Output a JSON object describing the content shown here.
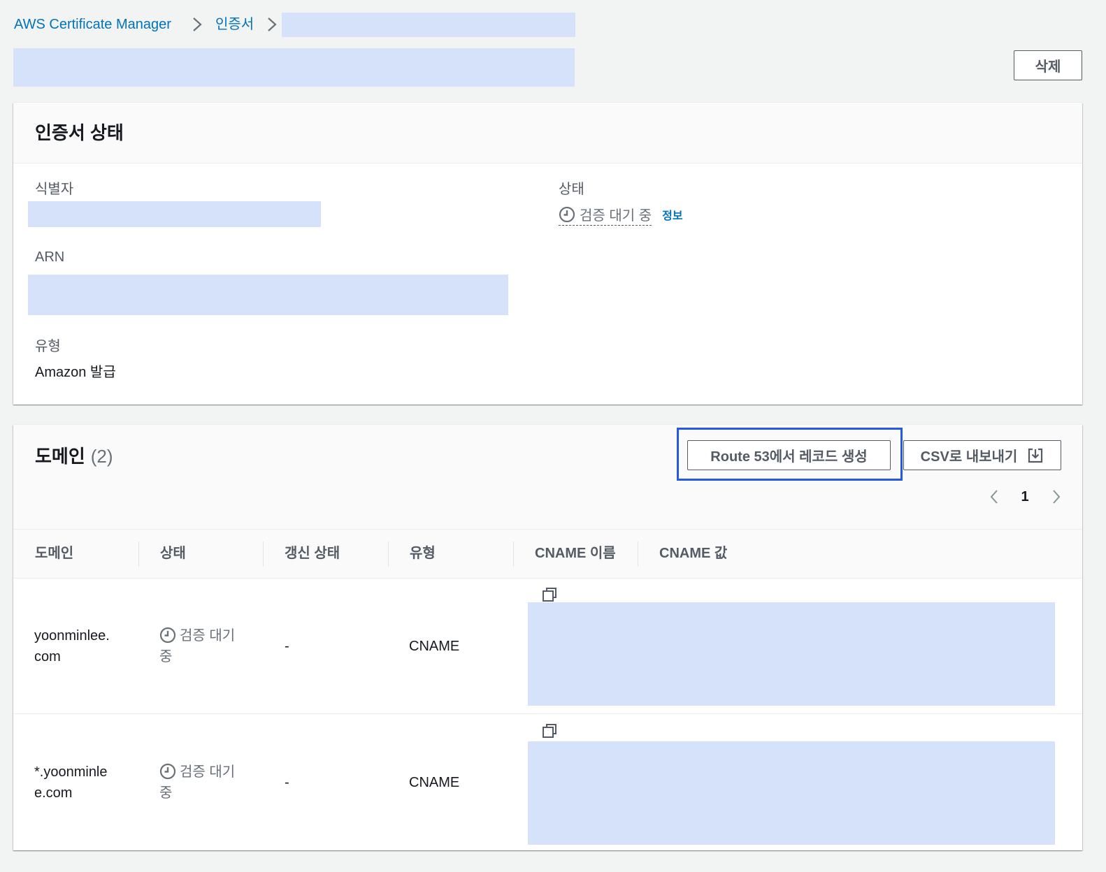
{
  "colors": {
    "page_background": "#f2f3f3",
    "link": "#0073bb",
    "text": "#16191f",
    "secondary_text": "#545b64",
    "pending_status": "#687078",
    "highlight_border": "#2459e6",
    "redacted_fill": "#d6e1fa"
  },
  "icons": {
    "breadcrumb_separator": "chevron-right-icon",
    "status": "clock-icon",
    "copy": "copy-icon",
    "export": "download-icon",
    "page_prev": "chevron-left-icon",
    "page_next": "chevron-right-icon"
  },
  "breadcrumb": {
    "items": [
      {
        "label": "AWS Certificate Manager"
      },
      {
        "label": "인증서"
      }
    ]
  },
  "header": {
    "delete_label": "삭제"
  },
  "status_panel": {
    "title": "인증서 상태",
    "identifier_label": "식별자",
    "arn_label": "ARN",
    "type_label": "유형",
    "type_value": "Amazon 발급",
    "status_label": "상태",
    "status_value": "검증 대기 중",
    "info_link": "정보"
  },
  "domains_panel": {
    "title": "도메인",
    "count_label": "(2)",
    "route53_button": "Route 53에서 레코드 생성",
    "csv_button": "CSV로 내보내기",
    "pagination": {
      "current_page": "1"
    },
    "columns": [
      "도메인",
      "상태",
      "갱신 상태",
      "유형",
      "CNAME 이름",
      "CNAME 값"
    ],
    "rows": [
      {
        "domain": "yoonminlee.com",
        "status": "검증 대기 중",
        "renewal_status": "-",
        "type": "CNAME"
      },
      {
        "domain": "*.yoonminlee.com",
        "status": "검증 대기 중",
        "renewal_status": "-",
        "type": "CNAME"
      }
    ]
  }
}
